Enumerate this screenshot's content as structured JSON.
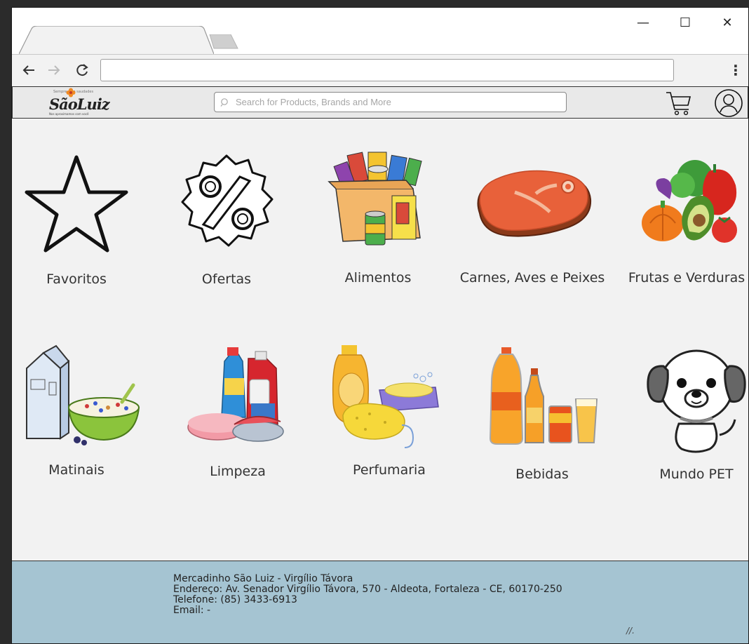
{
  "browser": {
    "window_controls": {
      "minimize": "—",
      "maximize": "☐",
      "close": "✕"
    },
    "address_bar_value": "",
    "menu_glyph": "⋮"
  },
  "header": {
    "logo_text": "SãoLuiz",
    "logo_tagline": "Sempre com saudades",
    "logo_slogan": "Nos aproximamos com você",
    "search_placeholder": "Search for Products, Brands and More",
    "icons": [
      "search-icon",
      "cart-icon",
      "user-icon"
    ]
  },
  "categories": [
    {
      "label": "Favoritos",
      "icon": "star-icon"
    },
    {
      "label": "Ofertas",
      "icon": "percent-badge-icon"
    },
    {
      "label": "Alimentos",
      "icon": "groceries-box-icon"
    },
    {
      "label": "Carnes, Aves e Peixes",
      "icon": "steak-icon"
    },
    {
      "label": "Frutas e Verduras",
      "icon": "vegetables-icon"
    },
    {
      "label": "Matinais",
      "icon": "milk-cereal-icon"
    },
    {
      "label": "Limpeza",
      "icon": "cleaning-products-icon"
    },
    {
      "label": "Perfumaria",
      "icon": "soap-sponge-icon"
    },
    {
      "label": "Bebidas",
      "icon": "bottles-icon"
    },
    {
      "label": "Mundo PET",
      "icon": "dog-icon"
    }
  ],
  "footer": {
    "lines": [
      "Mercadinho São Luiz - Virgílio Távora",
      "Endereço: Av. Senador Virgílio Távora, 570 - Aldeota, Fortaleza - CE, 60170-250",
      "Telefone: (85) 3433-6913",
      "Email: -"
    ],
    "grip": "//."
  },
  "colors": {
    "page_bg": "#f2f2f2",
    "footer_bg": "#a5c4d2",
    "header_bg": "#e9e9e9",
    "outer_bg": "#2b2b2b"
  }
}
